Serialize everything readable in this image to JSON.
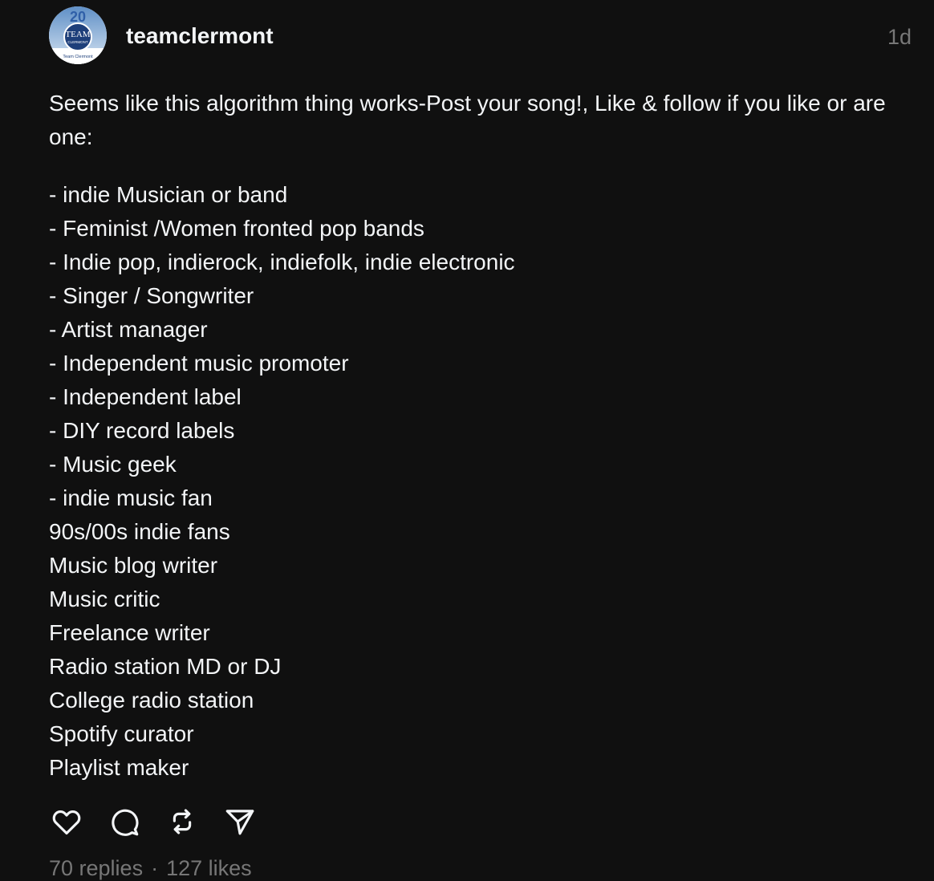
{
  "post": {
    "username": "teamclermont",
    "timestamp": "1d",
    "avatar": {
      "badge_number": "20",
      "logo_line1": "TEAM",
      "logo_line2": "CLERMONT",
      "footer_text": "Team Clermont"
    },
    "intro": "Seems like this algorithm thing works-Post your song!, Like & follow if you like or are one:",
    "items": [
      "- indie Musician or band",
      "- Feminist /Women fronted pop bands",
      "- Indie pop, indierock, indiefolk, indie electronic",
      "- Singer / Songwriter",
      "- Artist manager",
      "- Independent music promoter",
      "- Independent label",
      "- DIY record labels",
      "- Music geek",
      "- indie music fan",
      "90s/00s indie fans",
      "Music blog writer",
      "Music critic",
      "Freelance writer",
      "Radio station MD or DJ",
      "College radio station",
      "Spotify curator",
      "Playlist maker"
    ],
    "actions": {
      "like": "heart-icon",
      "reply": "comment-icon",
      "repost": "repost-icon",
      "share": "send-icon"
    },
    "stats": {
      "replies": "70 replies",
      "separator": "·",
      "likes": "127 likes"
    }
  },
  "colors": {
    "background": "#101010",
    "primary_text": "#f3f5f7",
    "secondary_text": "#777777"
  }
}
